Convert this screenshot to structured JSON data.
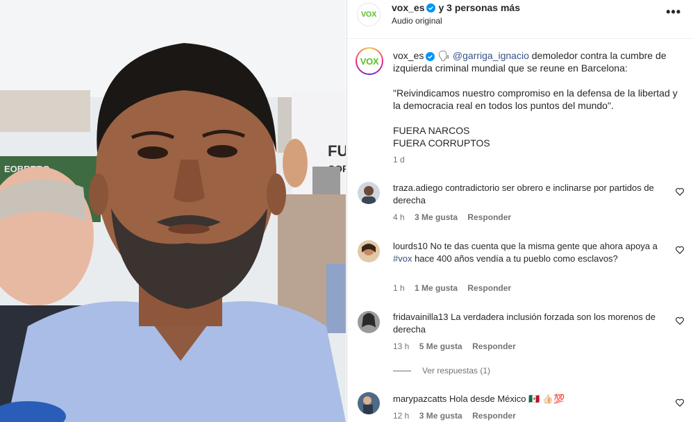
{
  "header": {
    "username": "vox_es",
    "others": "y 3 personas más",
    "audio": "Audio original",
    "more_icon": "more-horizontal-icon"
  },
  "logo_text": "VOX",
  "caption": {
    "username": "vox_es",
    "emoji": "🗣",
    "mention": "@garriga_ignacio",
    "line1_rest": " demoledor contra la cumbre de izquierda criminal mundial que se reune en Barcelona:",
    "quote": "\"Reivindicamos nuestro compromiso en la defensa de la libertad y la democracia real en todos los puntos del mundo\".",
    "shout1": "FUERA NARCOS",
    "shout2": "FUERA CORRUPTOS",
    "time": "1 d"
  },
  "comments": [
    {
      "username": "traza.adiego",
      "text": "contradictorio ser obrero e inclinarse por partidos de derecha",
      "time": "4 h",
      "likes": "3 Me gusta",
      "reply": "Responder"
    },
    {
      "username": "lourds10",
      "text_before": "No te das cuenta que la misma gente que ahora apoya a ",
      "hashtag": "#vox",
      "text_after": " hace 400 años vendía a tu pueblo como esclavos?",
      "time": "1 h",
      "likes": "1 Me gusta",
      "reply": "Responder"
    },
    {
      "username": "fridavainilla13",
      "text": "La verdadera inclusión forzada son los morenos de derecha",
      "time": "13 h",
      "likes": "5 Me gusta",
      "reply": "Responder",
      "view_replies": "Ver respuestas (1)"
    },
    {
      "username": "marypazcatts",
      "text": "Hola desde México 🇲🇽 👍🏻💯",
      "time": "12 h",
      "likes": "3 Me gusta",
      "reply": "Responder"
    }
  ],
  "colors": {
    "link": "#385185",
    "verified": "#0095f6",
    "secondary_text": "#737373",
    "vox_green": "#5bbf21"
  },
  "media": {
    "sign_text": "FU\nCOR",
    "banner_text": "EOBRERO"
  }
}
